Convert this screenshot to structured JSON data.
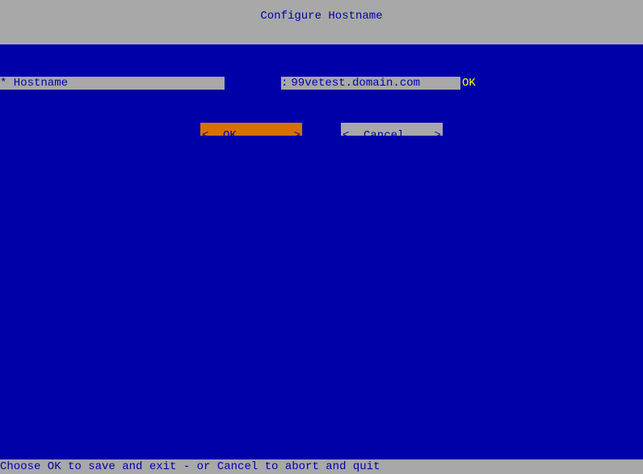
{
  "header": {
    "title": "Configure Hostname"
  },
  "form": {
    "label": "* Hostname",
    "colon": ":",
    "value": "99vetest.domain.com",
    "status": "OK"
  },
  "buttons": {
    "ok": {
      "left": "<",
      "label": "OK",
      "right": ">"
    },
    "cancel": {
      "left": "<",
      "label": "Cancel",
      "right": ">"
    }
  },
  "footer": {
    "hint": "Choose OK to save and exit - or Cancel to abort and quit"
  }
}
